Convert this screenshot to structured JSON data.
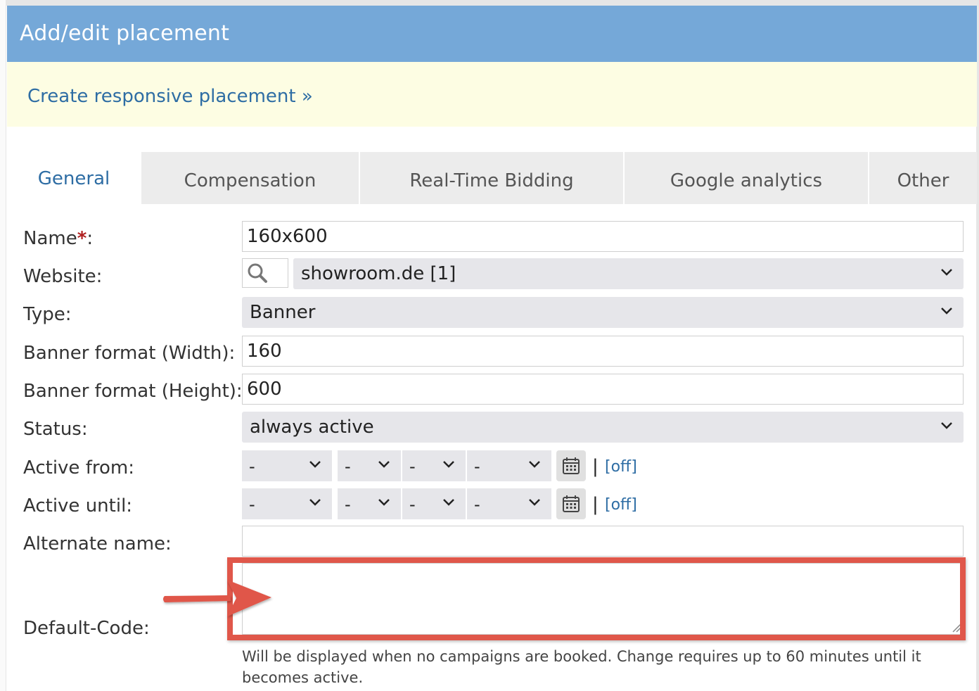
{
  "header": {
    "title": "Add/edit placement"
  },
  "notice": {
    "link": "Create responsive placement »"
  },
  "tabs": [
    {
      "label": "General",
      "active": true
    },
    {
      "label": "Compensation",
      "active": false
    },
    {
      "label": "Real-Time Bidding",
      "active": false
    },
    {
      "label": "Google analytics",
      "active": false
    },
    {
      "label": "Other",
      "active": false
    }
  ],
  "form": {
    "name": {
      "label": "Name",
      "required_mark": "*",
      "colon": ":",
      "value": "160x600"
    },
    "website": {
      "label": "Website:",
      "value": "showroom.de [1]",
      "search_icon": "search-icon"
    },
    "type": {
      "label": "Type:",
      "value": "Banner"
    },
    "width": {
      "label": "Banner format (Width):",
      "value": "160"
    },
    "height": {
      "label": "Banner format (Height):",
      "value": "600"
    },
    "status": {
      "label": "Status:",
      "value": "always active"
    },
    "active_from": {
      "label": "Active from:",
      "day": "-",
      "month": "-",
      "year": "-",
      "time": "-",
      "separator": "|",
      "toggle": "[off]",
      "calendar_icon": "calendar-icon"
    },
    "active_until": {
      "label": "Active until:",
      "day": "-",
      "month": "-",
      "year": "-",
      "time": "-",
      "separator": "|",
      "toggle": "[off]",
      "calendar_icon": "calendar-icon"
    },
    "alternate_name": {
      "label": "Alternate name:",
      "value": ""
    },
    "default_code": {
      "label": "Default-Code:",
      "value": "",
      "hint": "Will be displayed when no campaigns are booked. Change requires up to 60 minutes until it becomes active."
    }
  },
  "annotation": {
    "color": "#e0574a"
  },
  "colors": {
    "header": "#75a8d8",
    "notice": "#fdfde3",
    "link": "#2e6da4"
  }
}
